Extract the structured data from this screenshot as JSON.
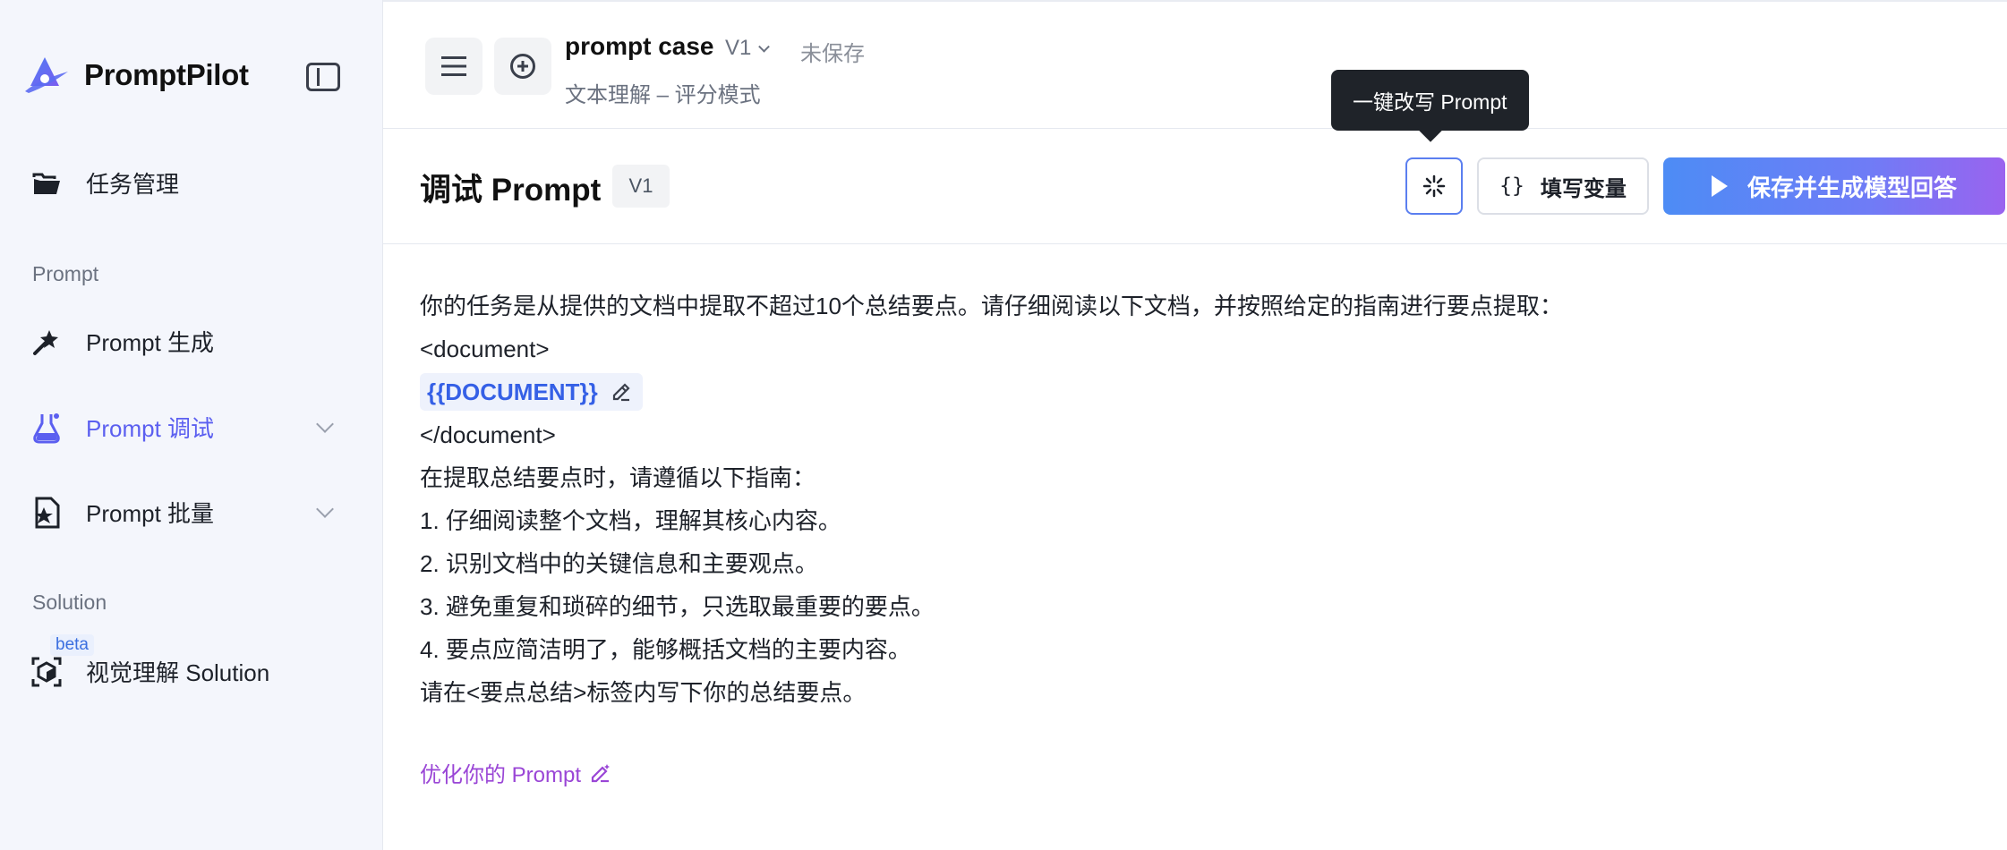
{
  "sidebar": {
    "brand": "PromptPilot",
    "nav": {
      "task_mgmt": "任务管理",
      "section_prompt": "Prompt",
      "prompt_gen": "Prompt 生成",
      "prompt_debug": "Prompt 调试",
      "prompt_batch": "Prompt 批量",
      "section_solution": "Solution",
      "vision_solution": "视觉理解 Solution",
      "beta": "beta"
    }
  },
  "header": {
    "title": "prompt case",
    "version": "V1",
    "status": "未保存",
    "subtitle": "文本理解 – 评分模式"
  },
  "tooltip": "一键改写 Prompt",
  "toolbar": {
    "title": "调试 Prompt",
    "version_tag": "V1",
    "fill_vars_label": "填写变量",
    "fill_vars_icon": "{}",
    "run_label": "保存并生成模型回答"
  },
  "prompt": {
    "lines": [
      "你的任务是从提供的文档中提取不超过10个总结要点。请仔细阅读以下文档，并按照给定的指南进行要点提取：",
      "<document>",
      "{{DOCUMENT}}",
      "</document>",
      "在提取总结要点时，请遵循以下指南：",
      "1. 仔细阅读整个文档，理解其核心内容。",
      "2. 识别文档中的关键信息和主要观点。",
      "3. 避免重复和琐碎的细节，只选取最重要的要点。",
      "4. 要点应简洁明了，能够概括文档的主要内容。",
      "请在<要点总结>标签内写下你的总结要点。"
    ]
  },
  "optimize_label": "优化你的 Prompt",
  "colors": {
    "accent": "#5b5ff0",
    "variable": "#3560e6",
    "optimize": "#9a46d6",
    "run_gradient_start": "#4d8cf5",
    "run_gradient_end": "#9a63ef"
  }
}
